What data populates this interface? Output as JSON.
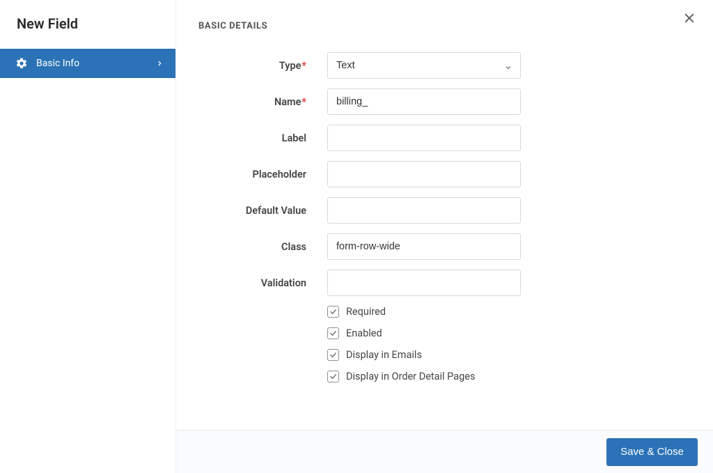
{
  "sidebar": {
    "title": "New Field",
    "items": [
      {
        "label": "Basic Info",
        "icon": "gear-icon",
        "active": true
      }
    ]
  },
  "section": {
    "title": "BASIC DETAILS"
  },
  "form": {
    "type": {
      "label": "Type",
      "required": true,
      "value": "Text"
    },
    "name": {
      "label": "Name",
      "required": true,
      "value": "billing_"
    },
    "label_field": {
      "label": "Label",
      "required": false,
      "value": ""
    },
    "placeholder": {
      "label": "Placeholder",
      "required": false,
      "value": ""
    },
    "default_value": {
      "label": "Default Value",
      "required": false,
      "value": ""
    },
    "class": {
      "label": "Class",
      "required": false,
      "value": "form-row-wide"
    },
    "validation": {
      "label": "Validation",
      "required": false,
      "value": ""
    }
  },
  "checkboxes": {
    "required": {
      "label": "Required",
      "checked": true
    },
    "enabled": {
      "label": "Enabled",
      "checked": true
    },
    "display_emails": {
      "label": "Display in Emails",
      "checked": true
    },
    "display_order_pages": {
      "label": "Display in Order Detail Pages",
      "checked": true
    }
  },
  "footer": {
    "save_label": "Save & Close"
  }
}
